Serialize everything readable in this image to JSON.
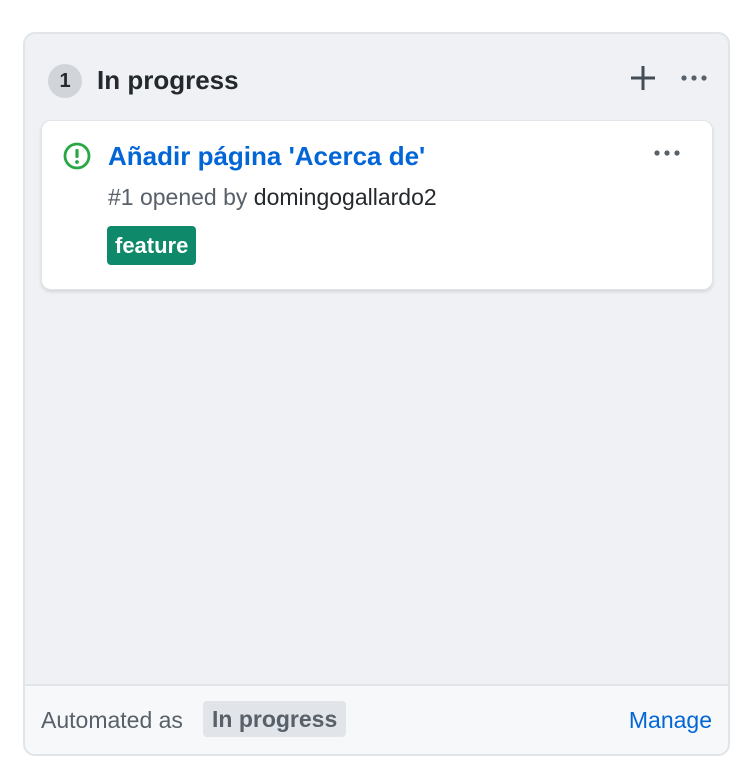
{
  "column": {
    "count": "1",
    "title": "In progress",
    "add_icon": "plus-icon",
    "menu_icon": "kebab-horizontal-icon"
  },
  "card": {
    "status_icon": "issue-opened-icon",
    "title": "Añadir página 'Acerca de'",
    "meta_prefix": "#1 opened by ",
    "author": "domingogallardo2",
    "label": "feature",
    "label_color": "#0e8a6b",
    "menu_icon": "kebab-horizontal-icon"
  },
  "footer": {
    "automated_text": "Automated as",
    "automated_value": "In progress",
    "manage_label": "Manage"
  },
  "colors": {
    "link": "#0366d6",
    "issue_open": "#28a745",
    "column_bg": "#eff1f4"
  }
}
